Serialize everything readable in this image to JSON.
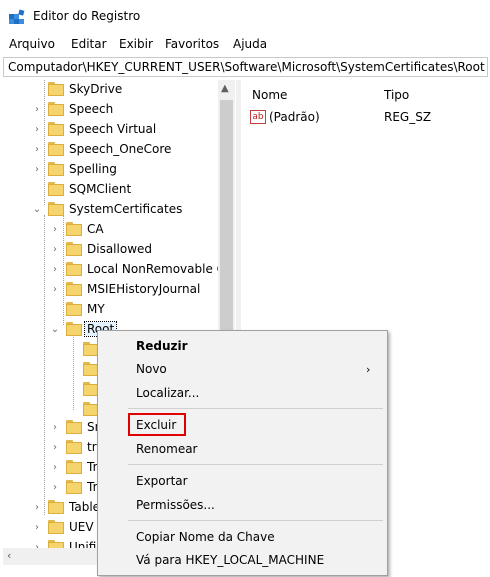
{
  "window": {
    "title": "Editor do Registro"
  },
  "menu": [
    "Arquivo",
    "Editar",
    "Exibir",
    "Favoritos",
    "Ajuda"
  ],
  "address": "Computador\\HKEY_CURRENT_USER\\Software\\Microsoft\\SystemCertificates\\Root",
  "tree": {
    "items": [
      {
        "label": "SkyDrive"
      },
      {
        "label": "Speech"
      },
      {
        "label": "Speech Virtual"
      },
      {
        "label": "Speech_OneCore"
      },
      {
        "label": "Spelling"
      },
      {
        "label": "SQMClient"
      },
      {
        "label": "SystemCertificates"
      },
      {
        "label": "CA"
      },
      {
        "label": "Disallowed"
      },
      {
        "label": "Local NonRemovable C"
      },
      {
        "label": "MSIEHistoryJournal"
      },
      {
        "label": "MY"
      },
      {
        "label": "Root"
      },
      {
        "label": "Sm"
      },
      {
        "label": "tru"
      },
      {
        "label": "Tr"
      },
      {
        "label": "Tr"
      },
      {
        "label": "Table"
      },
      {
        "label": "UEV"
      },
      {
        "label": "Unific"
      }
    ]
  },
  "values": {
    "headers": {
      "name": "Nome",
      "type": "Tipo"
    },
    "rows": [
      {
        "icon": "ab",
        "name": "(Padrão)",
        "type": "REG_SZ"
      }
    ]
  },
  "context_menu": {
    "items": [
      {
        "label": "Reduzir"
      },
      {
        "label": "Novo"
      },
      {
        "label": "Localizar..."
      },
      {
        "label": "Excluir"
      },
      {
        "label": "Renomear"
      },
      {
        "label": "Exportar"
      },
      {
        "label": "Permissões..."
      },
      {
        "label": "Copiar Nome da Chave"
      },
      {
        "label": "Vá para HKEY_LOCAL_MACHINE"
      }
    ]
  },
  "colors": {
    "highlight_border": "#e00000",
    "folder": "#f5d36d",
    "menu_bg": "#f2f2f2"
  }
}
